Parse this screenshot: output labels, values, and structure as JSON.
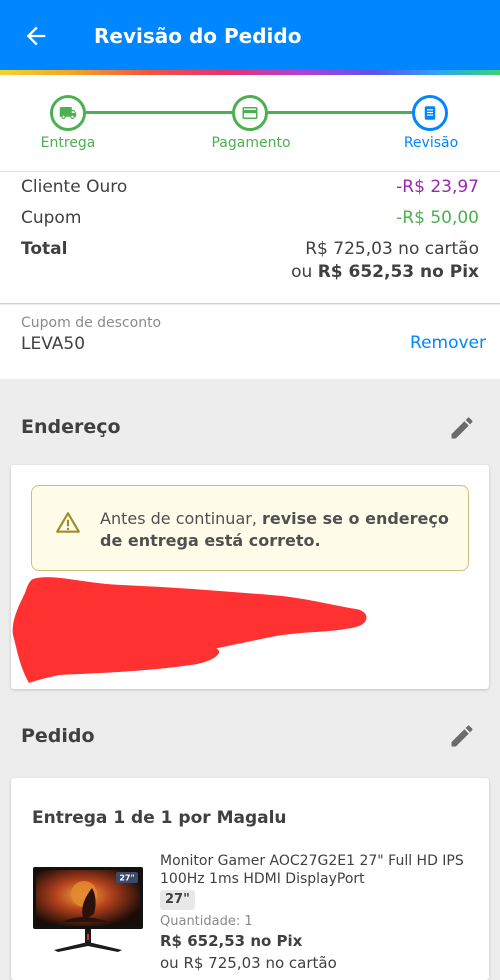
{
  "header": {
    "title": "Revisão do Pedido",
    "back_icon": "arrow-left-icon"
  },
  "stepper": {
    "steps": [
      {
        "label": "Entrega",
        "icon": "truck-icon",
        "state": "done"
      },
      {
        "label": "Pagamento",
        "icon": "credit-card-icon",
        "state": "done"
      },
      {
        "label": "Revisão",
        "icon": "document-icon",
        "state": "current"
      }
    ]
  },
  "summary": {
    "rows": [
      {
        "label": "Cliente Ouro",
        "value": "-R$ 23,97"
      },
      {
        "label": "Cupom",
        "value": "-R$ 50,00"
      }
    ],
    "total_label": "Total",
    "total_card": "R$ 725,03 no cartão",
    "total_pix_prefix": "ou",
    "total_pix_value": "R$ 652,53 no Pix"
  },
  "coupon": {
    "label": "Cupom de desconto",
    "code": "LEVA50",
    "remove_label": "Remover"
  },
  "address": {
    "title": "Endereço",
    "alert_text": "Antes de continuar,",
    "alert_bold": "revise se o endereço de entrega está correto."
  },
  "order": {
    "title": "Pedido",
    "shipment_title": "Entrega 1 de 1 por Magalu",
    "product_name": "Monitor Gamer AOC27G2E1 27\" Full HD IPS 100Hz 1ms HDMI DisplayPort",
    "size_badge": "27\"",
    "thumb_badge": "27\"",
    "quantity_label": "Quantidade:",
    "quantity_value": "1",
    "price_pix": "R$ 652,53 no Pix",
    "price_card": "ou R$ 725,03 no cartão"
  },
  "colors": {
    "primary": "#0086ff",
    "success": "#4caf50",
    "discount_purple": "#9c27b0",
    "alert_bg": "#fffde9",
    "redaction": "#ff3131"
  }
}
